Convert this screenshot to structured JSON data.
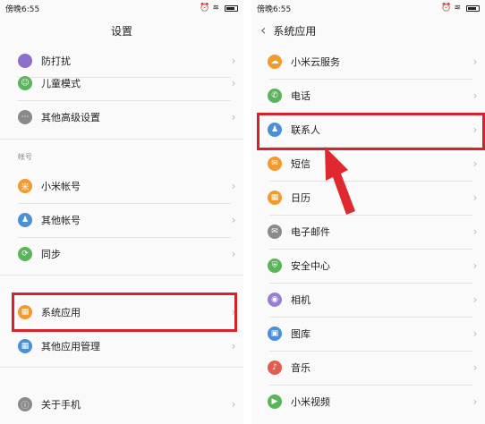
{
  "left": {
    "status": {
      "time": "傍晚6:55",
      "icons": "⏰ ≋"
    },
    "title": "设置",
    "items": [
      {
        "label": "防打扰",
        "icon": "moon-icon",
        "color": "#8b6fc9",
        "glyph": "☾"
      },
      {
        "label": "儿童模式",
        "icon": "child-mode-icon",
        "color": "#5ab45a",
        "glyph": "☺"
      },
      {
        "label": "其他高级设置",
        "icon": "more-settings-icon",
        "color": "#8a8a8a",
        "glyph": "⋯"
      }
    ],
    "section_accounts": "帐号",
    "accounts": [
      {
        "label": "小米帐号",
        "icon": "mi-account-icon",
        "color": "#f29a2e",
        "glyph": "米"
      },
      {
        "label": "其他帐号",
        "icon": "other-account-icon",
        "color": "#4a90d9",
        "glyph": "♟"
      },
      {
        "label": "同步",
        "icon": "sync-icon",
        "color": "#5ab45a",
        "glyph": "⟳"
      }
    ],
    "apps": [
      {
        "label": "系统应用",
        "icon": "system-apps-icon",
        "color": "#f29a2e",
        "glyph": "▦"
      },
      {
        "label": "其他应用管理",
        "icon": "app-management-icon",
        "color": "#4a90d9",
        "glyph": "▦"
      }
    ],
    "about": {
      "label": "关于手机",
      "icon": "about-phone-icon",
      "color": "#8a8a8a",
      "glyph": "ⓘ"
    }
  },
  "right": {
    "status": {
      "time": "傍晚6:55",
      "icons": "⏰ ≋"
    },
    "title": "系统应用",
    "items": [
      {
        "label": "小米云服务",
        "icon": "cloud-icon",
        "color": "#f29a2e",
        "glyph": "☁"
      },
      {
        "label": "电话",
        "icon": "phone-icon",
        "color": "#5ab45a",
        "glyph": "✆"
      },
      {
        "label": "联系人",
        "icon": "contacts-icon",
        "color": "#4a90d9",
        "glyph": "♟"
      },
      {
        "label": "短信",
        "icon": "sms-icon",
        "color": "#f29a2e",
        "glyph": "✉"
      },
      {
        "label": "日历",
        "icon": "calendar-icon",
        "color": "#f29a2e",
        "glyph": "▦"
      },
      {
        "label": "电子邮件",
        "icon": "email-icon",
        "color": "#8a8a8a",
        "glyph": "✉"
      },
      {
        "label": "安全中心",
        "icon": "security-icon",
        "color": "#5ab45a",
        "glyph": "⛨"
      },
      {
        "label": "相机",
        "icon": "camera-icon",
        "color": "#9a7fd1",
        "glyph": "◉"
      },
      {
        "label": "图库",
        "icon": "gallery-icon",
        "color": "#4a90d9",
        "glyph": "▣"
      },
      {
        "label": "音乐",
        "icon": "music-icon",
        "color": "#e35d4f",
        "glyph": "♪"
      },
      {
        "label": "小米视频",
        "icon": "video-icon",
        "color": "#5ab45a",
        "glyph": "▶"
      }
    ]
  },
  "colors": {
    "highlight": "#d5232b",
    "chevron": "#b8b8b8"
  }
}
